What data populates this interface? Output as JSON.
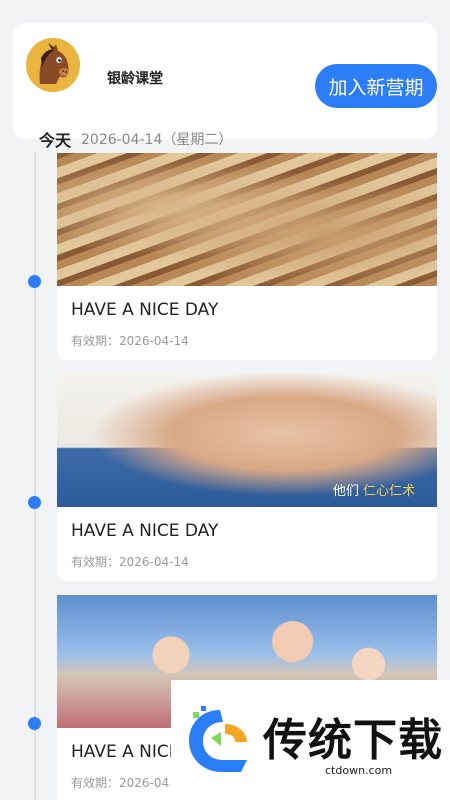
{
  "header": {
    "app_name": "银龄课堂",
    "join_button": "加入新营期",
    "today_label": "今天",
    "date_text": "2026-04-14（星期二）"
  },
  "cards": [
    {
      "title": "HAVE A NICE DAY",
      "validity": "有效期：2026-04-14",
      "image": "chinese-herbs-drawer"
    },
    {
      "title": "HAVE A NICE DAY",
      "validity": "有效期：2026-04-14",
      "image": "hand-massage",
      "caption_prefix": "他们",
      "caption_highlight": "仁心仁术"
    },
    {
      "title": "HAVE A NICE",
      "validity": "有效期：2026-04",
      "image": "family-photo"
    }
  ],
  "watermark": {
    "brand": "传统下载",
    "url": "ctdown.com"
  },
  "colors": {
    "accent": "#2c7ef8",
    "background": "#f2f3f5"
  }
}
